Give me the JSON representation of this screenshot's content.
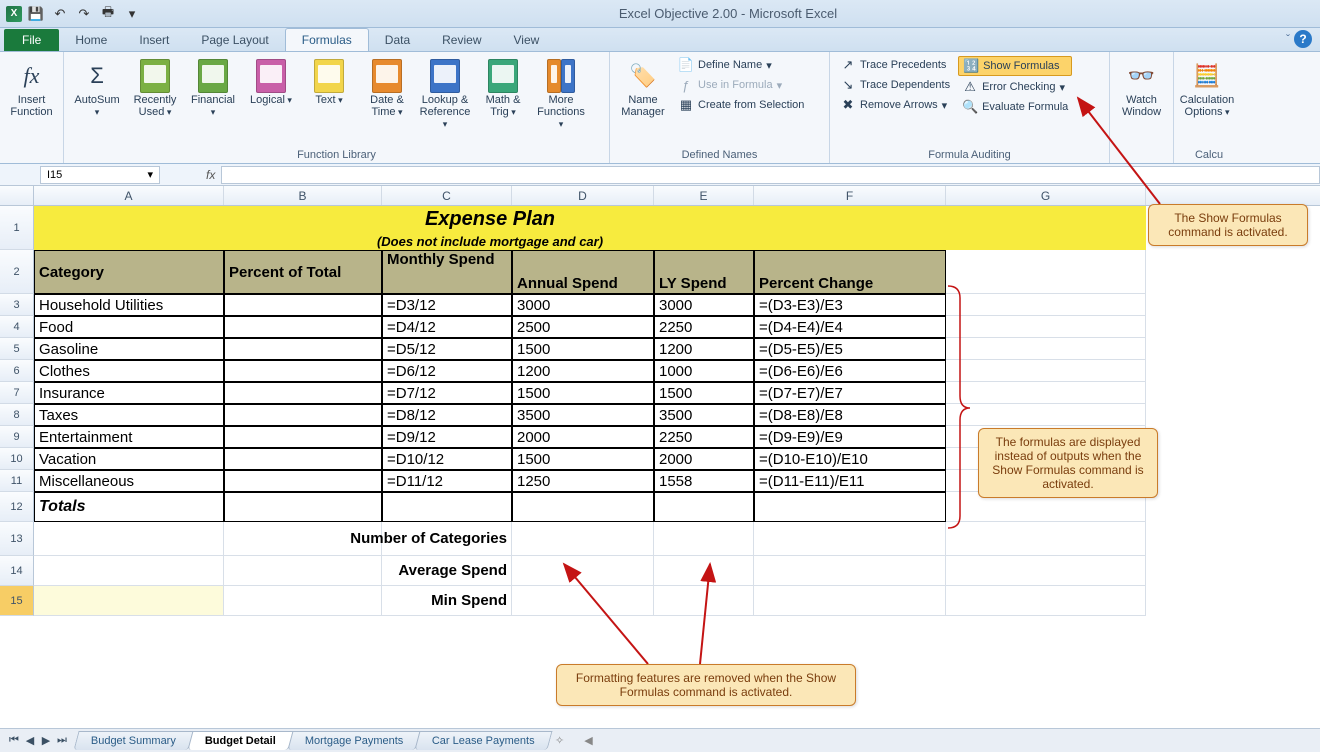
{
  "app": {
    "title": "Excel Objective 2.00  -  Microsoft Excel"
  },
  "qat": {
    "save": "💾",
    "undo": "↶",
    "redo": "↷",
    "print": "🖶"
  },
  "tabs": {
    "file": "File",
    "items": [
      "Home",
      "Insert",
      "Page Layout",
      "Formulas",
      "Data",
      "Review",
      "View"
    ],
    "active": "Formulas"
  },
  "ribbon": {
    "insert_function": "Insert Function",
    "autosum": "AutoSum",
    "recently_used": "Recently Used",
    "financial": "Financial",
    "logical": "Logical",
    "text": "Text",
    "date_time": "Date & Time",
    "lookup_ref": "Lookup & Reference",
    "math_trig": "Math & Trig",
    "more_functions": "More Functions",
    "group_function_library": "Function Library",
    "name_manager": "Name Manager",
    "define_name": "Define Name",
    "use_in_formula": "Use in Formula",
    "create_from_selection": "Create from Selection",
    "group_defined_names": "Defined Names",
    "trace_precedents": "Trace Precedents",
    "trace_dependents": "Trace Dependents",
    "remove_arrows": "Remove Arrows",
    "show_formulas": "Show Formulas",
    "error_checking": "Error Checking",
    "evaluate_formula": "Evaluate Formula",
    "group_formula_auditing": "Formula Auditing",
    "watch_window": "Watch Window",
    "calc_options": "Calculation Options",
    "group_calc": "Calcu"
  },
  "formula_bar": {
    "name_box": "I15",
    "fx": "fx"
  },
  "columns": [
    "A",
    "B",
    "C",
    "D",
    "E",
    "F",
    "G"
  ],
  "title_row": {
    "main": "Expense Plan",
    "sub": "(Does not include mortgage and car)"
  },
  "headers": {
    "A": "Category",
    "B": "Percent of Total",
    "C": "Monthly Spend",
    "D": "Annual Spend",
    "E": "LY Spend",
    "F": "Percent Change"
  },
  "data_rows": [
    {
      "n": 3,
      "A": "Household Utilities",
      "B": "",
      "C": "=D3/12",
      "D": "3000",
      "E": "3000",
      "F": "=(D3-E3)/E3"
    },
    {
      "n": 4,
      "A": "Food",
      "B": "",
      "C": "=D4/12",
      "D": "2500",
      "E": "2250",
      "F": "=(D4-E4)/E4"
    },
    {
      "n": 5,
      "A": "Gasoline",
      "B": "",
      "C": "=D5/12",
      "D": "1500",
      "E": "1200",
      "F": "=(D5-E5)/E5"
    },
    {
      "n": 6,
      "A": "Clothes",
      "B": "",
      "C": "=D6/12",
      "D": "1200",
      "E": "1000",
      "F": "=(D6-E6)/E6"
    },
    {
      "n": 7,
      "A": "Insurance",
      "B": "",
      "C": "=D7/12",
      "D": "1500",
      "E": "1500",
      "F": "=(D7-E7)/E7"
    },
    {
      "n": 8,
      "A": "Taxes",
      "B": "",
      "C": "=D8/12",
      "D": "3500",
      "E": "3500",
      "F": "=(D8-E8)/E8"
    },
    {
      "n": 9,
      "A": "Entertainment",
      "B": "",
      "C": "=D9/12",
      "D": "2000",
      "E": "2250",
      "F": "=(D9-E9)/E9"
    },
    {
      "n": 10,
      "A": "Vacation",
      "B": "",
      "C": "=D10/12",
      "D": "1500",
      "E": "2000",
      "F": "=(D10-E10)/E10"
    },
    {
      "n": 11,
      "A": "Miscellaneous",
      "B": "",
      "C": "=D11/12",
      "D": "1250",
      "E": "1558",
      "F": "=(D11-E11)/E11"
    }
  ],
  "totals_label": "Totals",
  "summary_labels": {
    "r13": "Number of Categories",
    "r14": "Average Spend",
    "r15": "Min Spend"
  },
  "callouts": {
    "c1": "The Show Formulas command is activated.",
    "c2": "The formulas are displayed instead of outputs when the Show Formulas command is activated.",
    "c3": "Formatting features are removed when the Show Formulas command is activated."
  },
  "sheet_tabs": [
    "Budget Summary",
    "Budget Detail",
    "Mortgage Payments",
    "Car Lease Payments"
  ],
  "active_sheet": "Budget Detail"
}
